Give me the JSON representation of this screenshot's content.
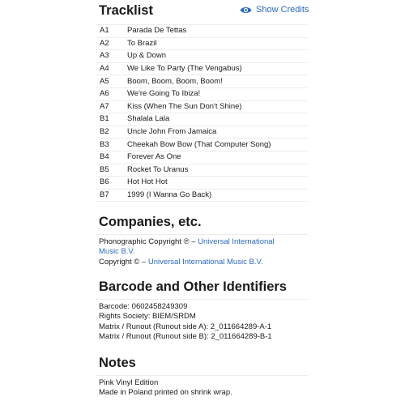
{
  "tracklist": {
    "title": "Tracklist",
    "show_credits_label": "Show Credits",
    "tracks": [
      {
        "position": "A1",
        "title": "Parada De Tettas"
      },
      {
        "position": "A2",
        "title": "To Brazil"
      },
      {
        "position": "A3",
        "title": "Up & Down"
      },
      {
        "position": "A4",
        "title": "We Like To Party (The Vengabus)"
      },
      {
        "position": "A5",
        "title": "Boom, Boom, Boom, Boom!"
      },
      {
        "position": "A6",
        "title": "We're Going To Ibiza!"
      },
      {
        "position": "A7",
        "title": "Kiss (When The Sun Don't Shine)"
      },
      {
        "position": "B1",
        "title": "Shalala Lala"
      },
      {
        "position": "B2",
        "title": "Uncle John From Jamaica"
      },
      {
        "position": "B3",
        "title": "Cheekah Bow Bow (That Computer Song)"
      },
      {
        "position": "B4",
        "title": "Forever As One"
      },
      {
        "position": "B5",
        "title": "Rocket To Uranus"
      },
      {
        "position": "B6",
        "title": "Hot Hot Hot"
      },
      {
        "position": "B7",
        "title": "1999 (I Wanna Go Back)"
      }
    ]
  },
  "companies": {
    "title": "Companies, etc.",
    "items": [
      {
        "role": "Phonographic Copyright ℗ – ",
        "name": "Universal International Music B.V."
      },
      {
        "role": "Copyright © – ",
        "name": "Universal International Music B.V."
      }
    ]
  },
  "identifiers": {
    "title": "Barcode and Other Identifiers",
    "lines": [
      "Barcode: 0602458249309",
      "Rights Society: BIEM/SRDM",
      "Matrix / Runout (Runout side A): 2_011664289-A-1",
      "Matrix / Runout (Runout side B): 2_011664289-B-1"
    ]
  },
  "notes": {
    "title": "Notes",
    "lines": [
      "Pink Vinyl Edition",
      "Made in Poland printed on shrink wrap."
    ]
  },
  "colors": {
    "link": "#2d6abf",
    "text": "#1a1a1a",
    "rule": "#ececec"
  },
  "icons": {
    "show_credits": "eye-icon"
  }
}
